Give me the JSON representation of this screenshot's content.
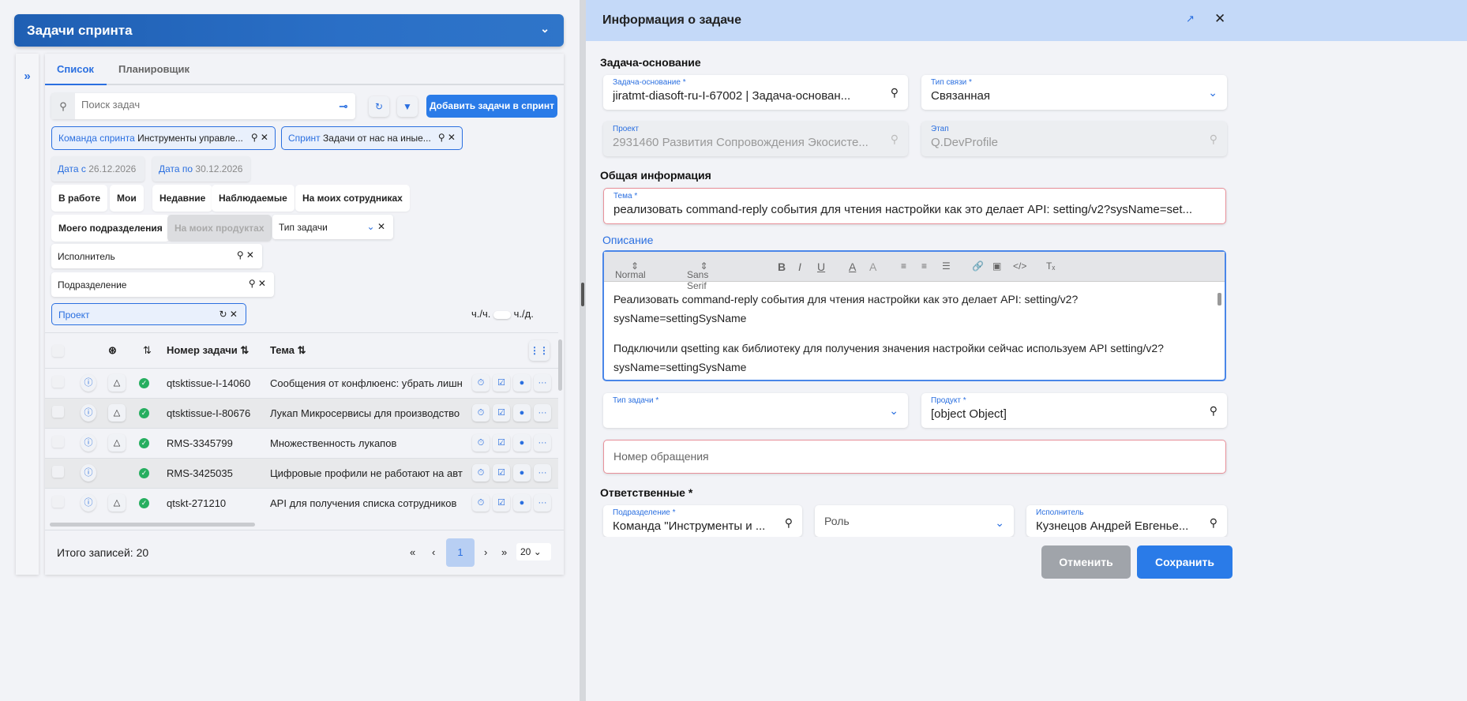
{
  "left": {
    "title": "Задачи спринта",
    "expand_icon": "»",
    "tabs": [
      "Список",
      "Планировщик"
    ],
    "search_placeholder": "Поиск задач",
    "add_button": "Добавить задачи в спринт",
    "chips": [
      {
        "label": "Команда спринта",
        "value": "Инструменты управле..."
      },
      {
        "label": "Спринт",
        "value": "Задачи от нас на иные..."
      }
    ],
    "dates": [
      {
        "label": "Дата с",
        "value": "26.12.2026"
      },
      {
        "label": "Дата по",
        "value": "30.12.2026"
      }
    ],
    "quick": [
      "В работе",
      "Мои",
      "Недавние",
      "Наблюдаемые",
      "На моих сотрудниках",
      "Моего подразделения",
      "На моих продуктах"
    ],
    "type_filter": "Тип задачи",
    "assignee_filter": "Исполнитель",
    "dept_filter": "Подразделение",
    "project_filter": "Проект",
    "toggle_left": "ч./ч.",
    "toggle_right": "ч./д.",
    "columns": {
      "number": "Номер задачи",
      "topic": "Тема"
    },
    "rows": [
      {
        "number": "qtsktissue-I-14060",
        "topic": "Сообщения от конфлюенс: убрать лишн",
        "tree": true
      },
      {
        "number": "qtsktissue-I-80676",
        "topic": "Лукап Микросервисы для производство",
        "tree": true
      },
      {
        "number": "RMS-3345799",
        "topic": "Множественность лукапов",
        "tree": true
      },
      {
        "number": "RMS-3425035",
        "topic": "Цифровые профили не работают на авт",
        "tree": false
      },
      {
        "number": "qtskt-271210",
        "topic": "API для получения списка сотрудников",
        "tree": true
      }
    ],
    "total": "Итого записей: 20",
    "page": "1",
    "page_size": "20"
  },
  "right": {
    "title": "Информация о задаче",
    "sec_base": "Задача-основание",
    "base_task": {
      "label": "Задача-основание *",
      "value": "jiratmt-diasoft-ru-I-67002 | Задача-основан..."
    },
    "link_type": {
      "label": "Тип связи *",
      "value": "Связанная"
    },
    "project": {
      "label": "Проект",
      "value": "2931460 Развития Сопровождения Экосисте..."
    },
    "stage": {
      "label": "Этап",
      "value": "Q.DevProfile"
    },
    "sec_general": "Общая информация",
    "topic": {
      "label": "Тема *",
      "value": "реализовать command-reply события для чтения настройки как это делает API:  setting/v2?sysName=set..."
    },
    "desc_label": "Описание",
    "toolbar": {
      "format": "Normal",
      "font": "Sans Serif"
    },
    "desc_p1": "Реализовать command-reply события для чтения настройки как это делает API: setting/v2?sysName=settingSysName",
    "desc_p2": "Подключили qsetting как библиотеку для получения значения настройки сейчас используем API setting/v2?sysName=settingSysName",
    "task_type": {
      "label": "Тип задачи *",
      "value": ""
    },
    "product": {
      "label": "Продукт *",
      "value": "[object Object]"
    },
    "request_placeholder": "Номер обращения",
    "sec_resp": "Ответственные *",
    "dept": {
      "label": "Подразделение *",
      "value": "Команда \"Инструменты и ..."
    },
    "role_placeholder": "Роль",
    "assignee": {
      "label": "Исполнитель",
      "value": "Кузнецов Андрей Евгенье..."
    },
    "cancel": "Отменить",
    "save": "Сохранить"
  }
}
